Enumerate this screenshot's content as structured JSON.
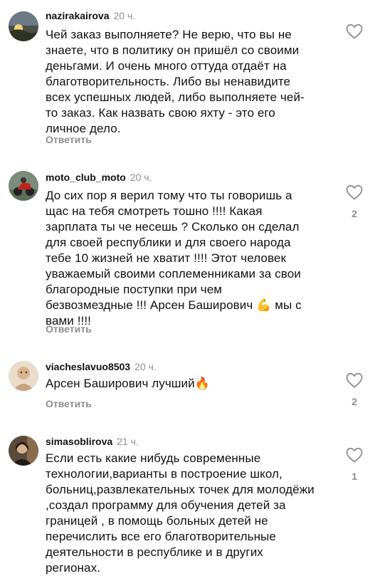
{
  "comments": [
    {
      "username": "nazirakairova",
      "time": "20 ч.",
      "text": "Чей заказ выполняете? Не верю, что вы не\nзнаете, что в политику он пришёл со своими\nденьгами. И очень много оттуда отдаёт на\nблаготворительность. Либо вы ненавидите\nвсех успешных людей, либо выполняете чей-\nто заказ. Как назвать свою яхту - это его\nличное дело.",
      "reply": "Ответить",
      "likes": ""
    },
    {
      "username": "moto_club_moto",
      "time": "20 ч.",
      "text": "До сих пор я верил тому что ты говоришь а\nщас на тебя смотреть тошно !!!! Какая\nзарплата ты че несешь ? Сколько он сделал\nдля своей республики и для своего народа\nтебе 10 жизней не хватит !!!! Этот человек\nуважаемый своими соплеменниками за свои\nблагородные поступки при чем\nбезвозмездные !!! Арсен Баширович 💪 мы с\nвами !!!!",
      "reply": "Ответить",
      "likes": "2"
    },
    {
      "username": "viacheslavuo8503",
      "time": "20 ч.",
      "text": "Арсен Баширович лучший🔥",
      "reply": "Ответить",
      "likes": "2"
    },
    {
      "username": "simasoblirova",
      "time": "21 ч.",
      "text": "Если есть  какие нибудь современные\nтехнологии,варианты в построение школ,\nбольниц,развлекательных точек для молодёжи\n,создал программу для обучения детей за\nграницей , в помощь больных детей не\nперечислить все  его благотворительные\nдеятельности в республике  и в  других\nрегионах.",
      "reply": "",
      "likes": "1"
    }
  ],
  "icons": {
    "like": "heart-outline-icon"
  },
  "colors": {
    "muted": "#8e8e8e",
    "text": "#111111"
  }
}
